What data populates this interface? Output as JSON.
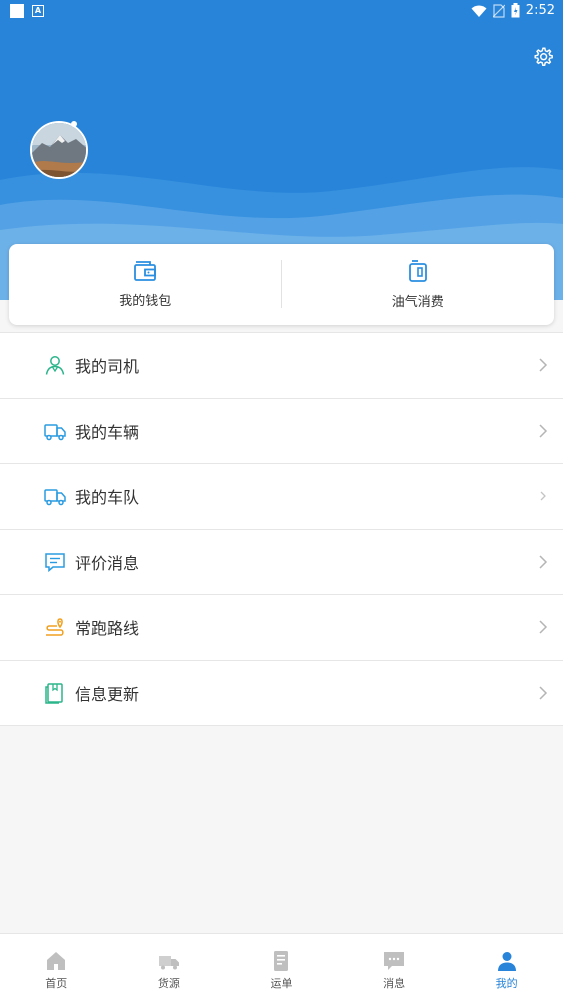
{
  "status_bar": {
    "time": "2:52",
    "icons": [
      "notification-square-icon",
      "android-a-icon",
      "wifi-icon",
      "no-sim-icon",
      "battery-icon"
    ]
  },
  "header": {
    "settings_icon": "gear-icon",
    "background_color": "#2784d9"
  },
  "quick_actions": [
    {
      "label": "我的钱包",
      "icon": "wallet-icon"
    },
    {
      "label": "油气消费",
      "icon": "fuel-icon"
    }
  ],
  "menu": [
    {
      "label": "我的司机",
      "icon": "driver-icon",
      "icon_color": "#2bb58a"
    },
    {
      "label": "我的车辆",
      "icon": "truck-icon",
      "icon_color": "#2a9be0"
    },
    {
      "label": "我的车队",
      "icon": "truck-icon",
      "icon_color": "#2a9be0"
    },
    {
      "label": "评价消息",
      "icon": "message-icon",
      "icon_color": "#2a9be0"
    },
    {
      "label": "常跑路线",
      "icon": "route-icon",
      "icon_color": "#f0a020"
    },
    {
      "label": "信息更新",
      "icon": "document-icon",
      "icon_color": "#2bb58a"
    }
  ],
  "bottom_nav": [
    {
      "label": "首页",
      "icon": "home-icon"
    },
    {
      "label": "货源",
      "icon": "cargo-truck-icon"
    },
    {
      "label": "运单",
      "icon": "waybill-icon"
    },
    {
      "label": "消息",
      "icon": "chat-icon"
    },
    {
      "label": "我的",
      "icon": "person-icon",
      "active": true
    }
  ],
  "colors": {
    "accent": "#2784d9",
    "inactive_nav": "#bfbfbf"
  }
}
